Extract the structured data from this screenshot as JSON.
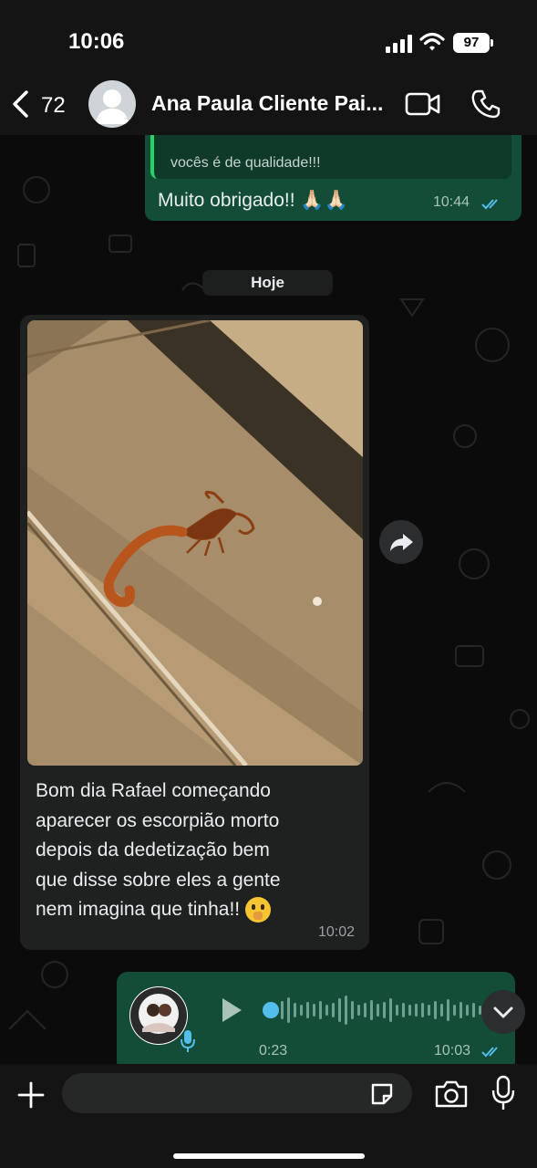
{
  "status_bar": {
    "time": "10:06",
    "battery": "97"
  },
  "header": {
    "back_count": "72",
    "contact_name": "Ana Paula Cliente Pai..."
  },
  "messages": [
    {
      "direction": "outgoing",
      "quoted_text": "vocês é de qualidade!!!",
      "text": "Muito obrigado!! 🙏🏻🙏🏻",
      "time": "10:44",
      "status": "read"
    },
    {
      "type": "date_separator",
      "text": "Hoje"
    },
    {
      "direction": "incoming",
      "media": "photo",
      "caption_lines": [
        "Bom dia Rafael começando",
        "aparecer os escorpião morto",
        "depois da dedetização bem",
        "que disse sobre eles a gente",
        "nem imagina que tinha!!"
      ],
      "time": "10:02"
    },
    {
      "direction": "outgoing",
      "type": "voice",
      "duration": "0:23",
      "time": "10:03",
      "status": "read"
    }
  ],
  "icons": {
    "back": "chevron-left-icon",
    "avatar": "person-icon",
    "video": "video-camera-icon",
    "phone": "phone-icon",
    "forward": "forward-icon",
    "play": "play-icon",
    "scroll": "chevron-down-icon",
    "plus": "plus-icon",
    "sticker": "sticker-icon",
    "camera": "camera-icon",
    "mic": "microphone-icon"
  },
  "colors": {
    "outgoing_bubble": "#144d37",
    "incoming_bubble": "#1f2020",
    "read_ticks": "#53bdeb",
    "accent": "#25d366"
  }
}
